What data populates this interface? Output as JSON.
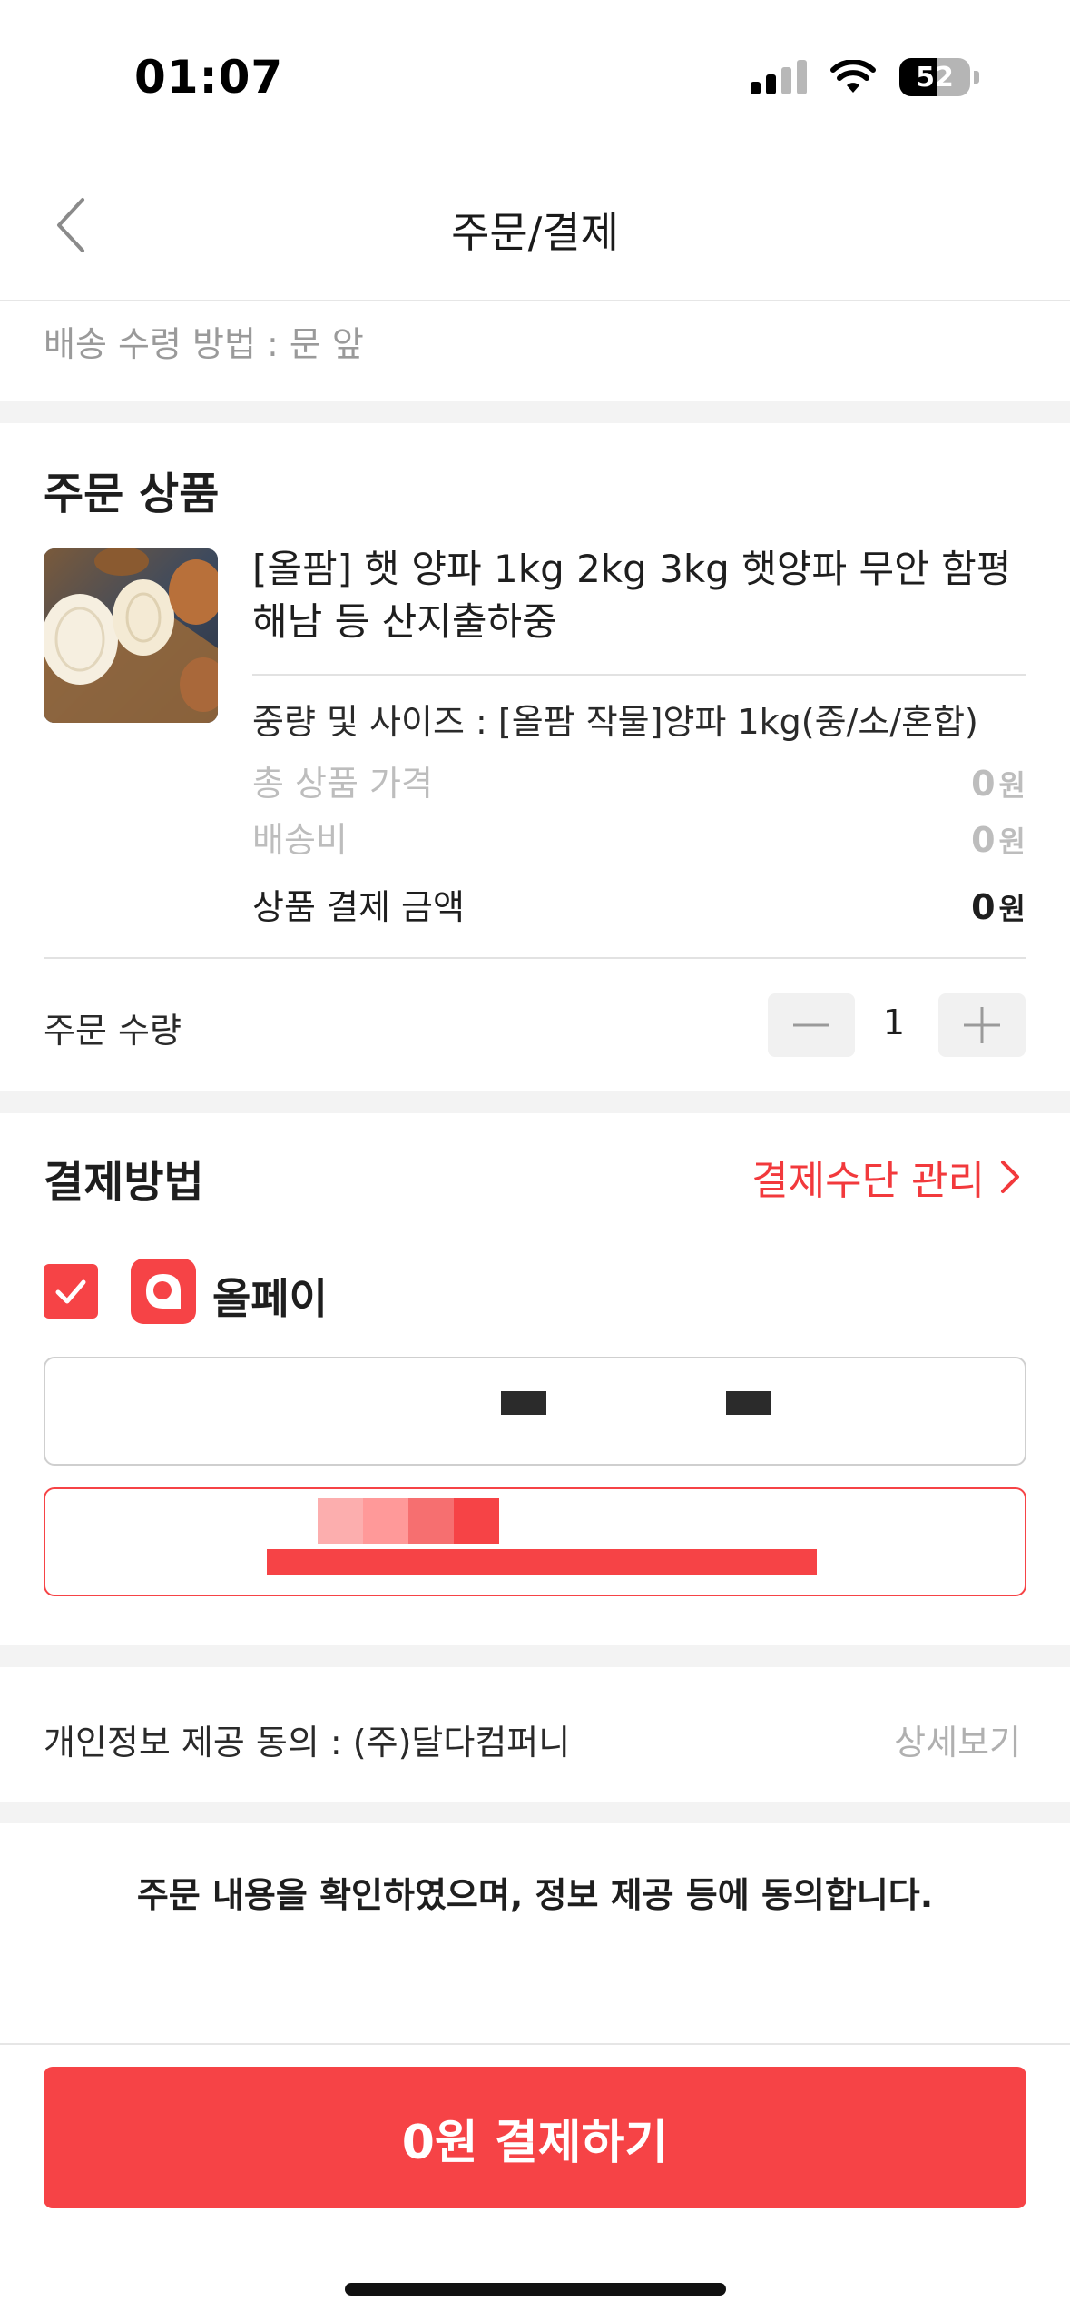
{
  "status_bar": {
    "time": "01:07",
    "battery": "52"
  },
  "header": {
    "title": "주문/결제",
    "back_icon": "chevron-left-icon"
  },
  "delivery": {
    "method_text": "배송 수령 방법 : 문 앞"
  },
  "order_product": {
    "section_title": "주문 상품",
    "name": "[올팜] 햇 양파 1kg 2kg 3kg 햇양파 무안 함평 해남 등 산지출하중",
    "option": "중량 및 사이즈 : [올팜 작물]양파 1kg(중/소/혼합)",
    "total_price_label": "총 상품 가격",
    "total_price_value": "0",
    "shipping_label": "배송비",
    "shipping_value": "0",
    "payment_amount_label": "상품 결제 금액",
    "payment_amount_value": "0",
    "currency_unit": "원"
  },
  "quantity": {
    "label": "주문 수량",
    "value": "1"
  },
  "payment": {
    "section_title": "결제방법",
    "manage_link": "결제수단 관리",
    "method_name": "올페이",
    "method_checked": true,
    "accent_color": "#f64346"
  },
  "privacy": {
    "label": "개인정보 제공 동의 : (주)달다컴퍼니",
    "detail_link": "상세보기"
  },
  "agreement": {
    "text": "주문 내용을 확인하였으며, 정보 제공 등에 동의합니다."
  },
  "pay_button": {
    "label": "0원 결제하기"
  }
}
